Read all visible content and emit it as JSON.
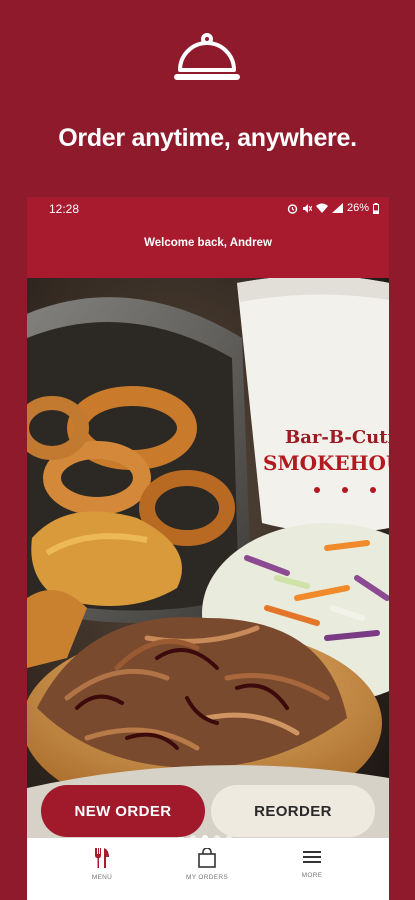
{
  "promo": {
    "headline": "Order anytime, anywhere.",
    "icon": "cloche-icon"
  },
  "status_bar": {
    "time": "12:28",
    "battery": "26%"
  },
  "app_bar": {
    "welcome": "Welcome back, Andrew"
  },
  "hero": {
    "image": "bbq-plate-photo",
    "cup_brand_line1": "Bar-B-Cutie",
    "cup_brand_line2": "SMOKEHOUSE",
    "carousel_pages": 5,
    "carousel_active": 2
  },
  "actions": {
    "new_order": "NEW ORDER",
    "reorder": "REORDER"
  },
  "bottom_nav": {
    "menu": "MENU",
    "my_orders": "MY ORDERS",
    "more": "MORE"
  },
  "colors": {
    "brand": "#a81b2f",
    "background": "#8e1a2c",
    "reorder_bg": "#eeeae0"
  }
}
